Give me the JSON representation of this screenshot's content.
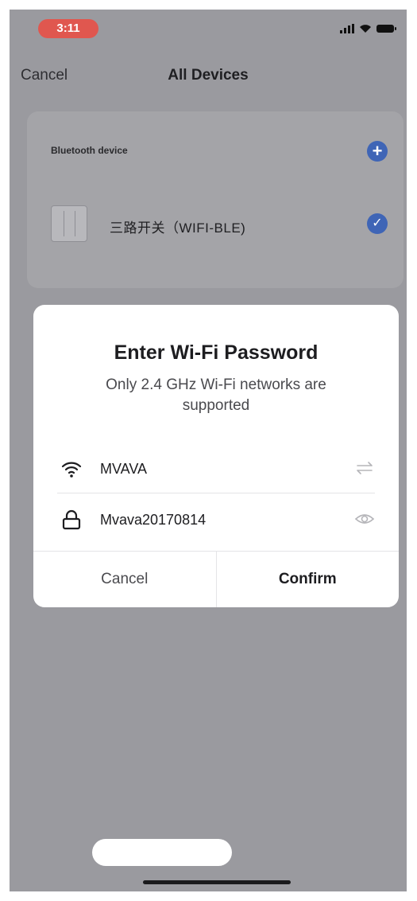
{
  "status_bar": {
    "time": "3:11",
    "icons": [
      "signal-icon",
      "wifi-icon",
      "battery-icon"
    ]
  },
  "nav": {
    "cancel_label": "Cancel",
    "title": "All Devices"
  },
  "device_list": {
    "section_label": "Bluetooth device",
    "devices": [
      {
        "name": "三路开关（WIFI-BLE)",
        "selected": true
      }
    ]
  },
  "dialog": {
    "title": "Enter Wi-Fi Password",
    "subtitle": "Only 2.4 GHz Wi-Fi networks are supported",
    "ssid": "MVAVA",
    "password": "Mvava20170814",
    "cancel_label": "Cancel",
    "confirm_label": "Confirm"
  },
  "colors": {
    "accent": "#3f65b6",
    "time_pill": "#e0574f",
    "overlay": "#9a9a9f"
  }
}
